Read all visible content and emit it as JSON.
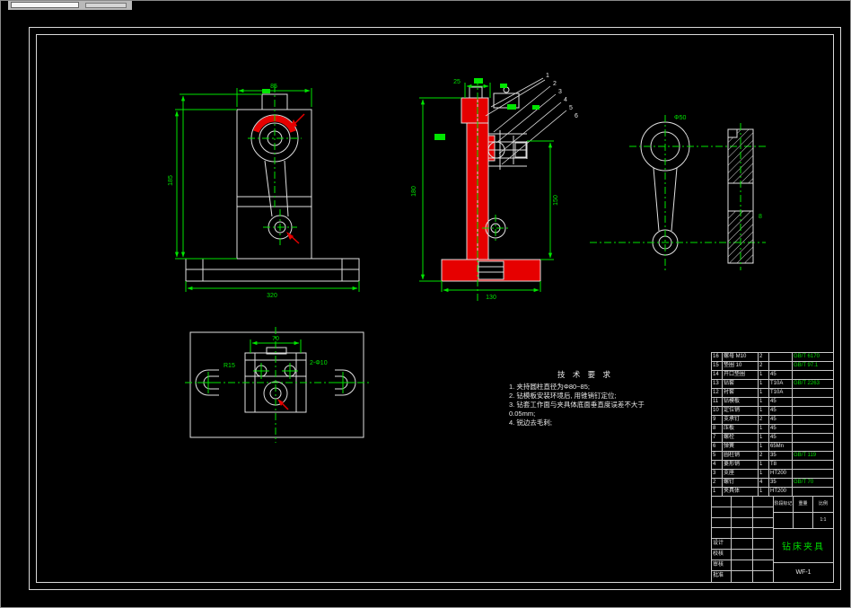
{
  "tech": {
    "title": "技 术 要 求",
    "lines": [
      "1. 夹持圆柱直径为Φ80~85;",
      "2. 钻模板安装环境后, 用锥销钉定位;",
      "3. 钻套工作面与夹具体底面垂直度误差不大于",
      "   0.05mm;",
      "4. 锐边去毛刺;"
    ]
  },
  "dims": {
    "front_top": "85",
    "front_left": "185",
    "front_bottom": "320",
    "sec_top": "25",
    "sec_left": "180",
    "sec_right": "150",
    "sec_bottom": "130",
    "rod_dia": "Φ50",
    "bar_w": "8",
    "plan_top": "70",
    "plan_left": "R15",
    "plan_right": "2-Φ10"
  },
  "callouts": {
    "list": [
      "1",
      "2",
      "3",
      "4",
      "5",
      "6"
    ]
  },
  "bom": {
    "rows": [
      {
        "no": "16",
        "name": "螺母 M10",
        "qty": "2",
        "mat": "",
        "note": "GB/T 6170"
      },
      {
        "no": "15",
        "name": "垫圈 10",
        "qty": "2",
        "mat": "",
        "note": "GB/T 97.1"
      },
      {
        "no": "14",
        "name": "开口垫圈",
        "qty": "1",
        "mat": "45",
        "note": ""
      },
      {
        "no": "13",
        "name": "钻套",
        "qty": "1",
        "mat": "T10A",
        "note": "GB/T 2263"
      },
      {
        "no": "12",
        "name": "衬套",
        "qty": "1",
        "mat": "T10A",
        "note": ""
      },
      {
        "no": "11",
        "name": "钻模板",
        "qty": "1",
        "mat": "45",
        "note": ""
      },
      {
        "no": "10",
        "name": "定位销",
        "qty": "1",
        "mat": "45",
        "note": ""
      },
      {
        "no": "9",
        "name": "支承钉",
        "qty": "2",
        "mat": "45",
        "note": ""
      },
      {
        "no": "8",
        "name": "压板",
        "qty": "1",
        "mat": "45",
        "note": ""
      },
      {
        "no": "7",
        "name": "螺栓",
        "qty": "1",
        "mat": "45",
        "note": ""
      },
      {
        "no": "6",
        "name": "弹簧",
        "qty": "1",
        "mat": "65Mn",
        "note": ""
      },
      {
        "no": "5",
        "name": "圆柱销",
        "qty": "2",
        "mat": "35",
        "note": "GB/T 119"
      },
      {
        "no": "4",
        "name": "菱形销",
        "qty": "1",
        "mat": "T8",
        "note": ""
      },
      {
        "no": "3",
        "name": "支座",
        "qty": "1",
        "mat": "HT200",
        "note": ""
      },
      {
        "no": "2",
        "name": "螺钉",
        "qty": "4",
        "mat": "35",
        "note": "GB/T 70"
      },
      {
        "no": "1",
        "name": "夹具体",
        "qty": "1",
        "mat": "HT200",
        "note": ""
      }
    ]
  },
  "titleblock": {
    "design": "设计",
    "check": "校核",
    "audit": "审核",
    "approve": "批准",
    "stage": "阶段标记",
    "weight": "重量",
    "scale": "比例",
    "scale_val": "1:1",
    "title": "钻床夹具",
    "code": "WF-1"
  }
}
